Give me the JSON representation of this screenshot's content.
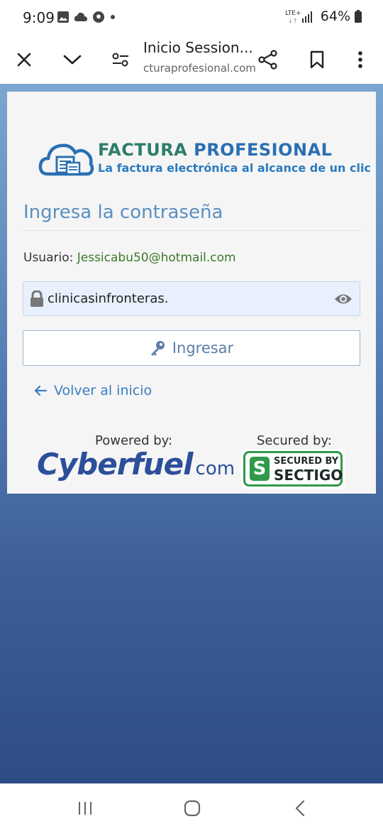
{
  "status_bar": {
    "time": "9:09",
    "network": "LTE+",
    "battery": "64%",
    "icons": [
      "gallery-icon",
      "cloud-icon",
      "soccer-ball-icon",
      "dot-icon",
      "signal-icon",
      "battery-icon"
    ]
  },
  "toolbar": {
    "title": "Inicio Session...",
    "url": "cturaprofesional.com",
    "icons": [
      "close-icon",
      "chevron-down-icon",
      "tune-icon",
      "share-icon",
      "bookmark-icon",
      "more-vert-icon"
    ]
  },
  "logo": {
    "title_part1": "FACTURA ",
    "title_part2": "PROFESIONAL",
    "subtitle": "La factura electrónica al alcance de un clic"
  },
  "login": {
    "heading": "Ingresa la contraseña",
    "user_label": "Usuario: ",
    "user_email": "Jessicabu50@hotmail.com",
    "password_value": "clinicasinfronteras.",
    "submit_label": "Ingresar",
    "back_label": "Volver al inicio"
  },
  "footer": {
    "powered_label": "Powered by:",
    "secured_label": "Secured by:",
    "cyberfuel_main": "Cyberfuel",
    "cyberfuel_com": "com",
    "sectigo_line1": "SECURED BY",
    "sectigo_line2": "SECTIGO",
    "sectigo_mark": "S"
  },
  "colors": {
    "heading": "#5b8fc1",
    "email": "#3b7a2a",
    "link": "#3b7dbf",
    "sectigo_green": "#2f9a4a",
    "cyberfuel_blue": "#2b4f9a"
  },
  "navbar": {
    "icons": [
      "recent-apps-icon",
      "home-icon",
      "back-icon"
    ]
  }
}
